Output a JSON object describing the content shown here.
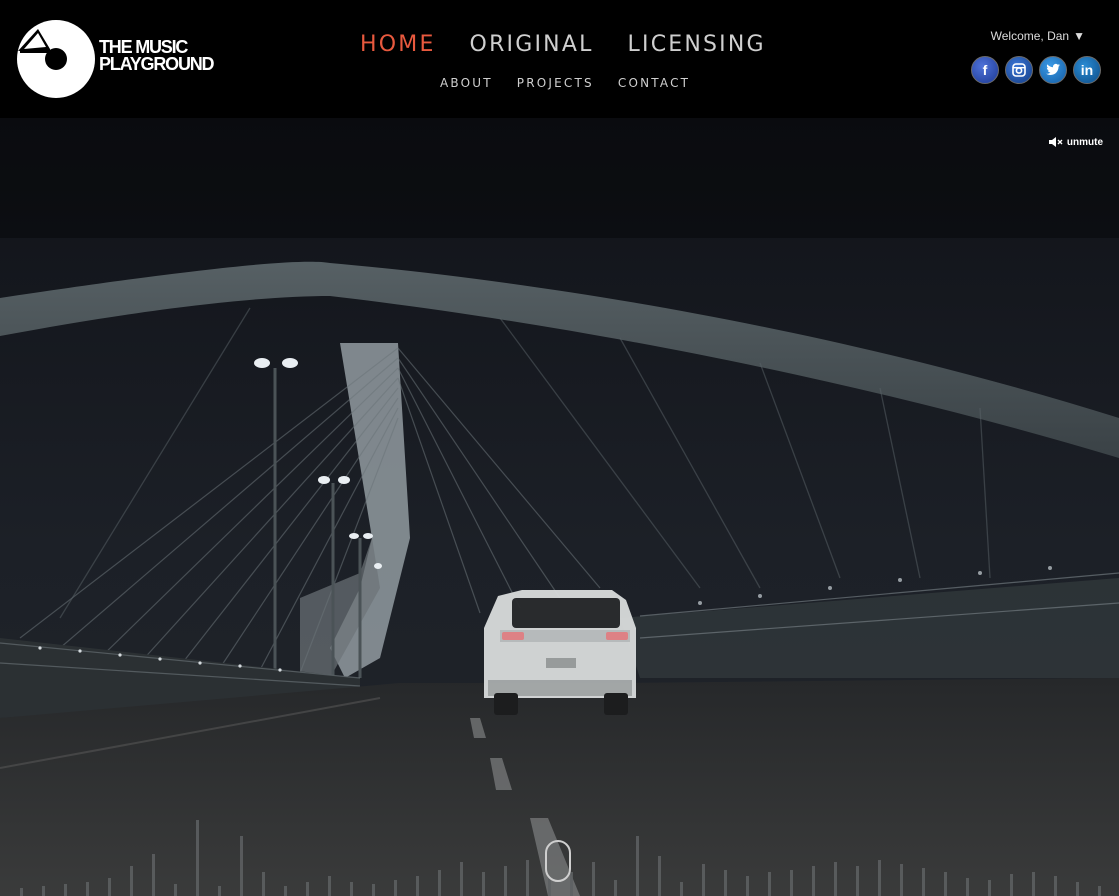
{
  "brand": {
    "line1": "THE MUSIC",
    "line2": "PLAYGROUND"
  },
  "nav": {
    "primary": [
      {
        "label": "HOME",
        "active": true
      },
      {
        "label": "ORIGINAL",
        "active": false
      },
      {
        "label": "LICENSING",
        "active": false
      }
    ],
    "secondary": [
      {
        "label": "ABOUT"
      },
      {
        "label": "PROJECTS"
      },
      {
        "label": "CONTACT"
      }
    ]
  },
  "user": {
    "welcome": "Welcome, Dan",
    "caret": "▼"
  },
  "socials": [
    {
      "icon": "facebook-icon",
      "glyph": "f"
    },
    {
      "icon": "instagram-icon",
      "glyph": "◙"
    },
    {
      "icon": "twitter-icon",
      "glyph": "t"
    },
    {
      "icon": "linkedin-icon",
      "glyph": "in"
    }
  ],
  "video": {
    "unmute_label": "unmute"
  },
  "colors": {
    "accent": "#e8593e",
    "nav_text": "#cfcfcf",
    "background": "#000000"
  }
}
